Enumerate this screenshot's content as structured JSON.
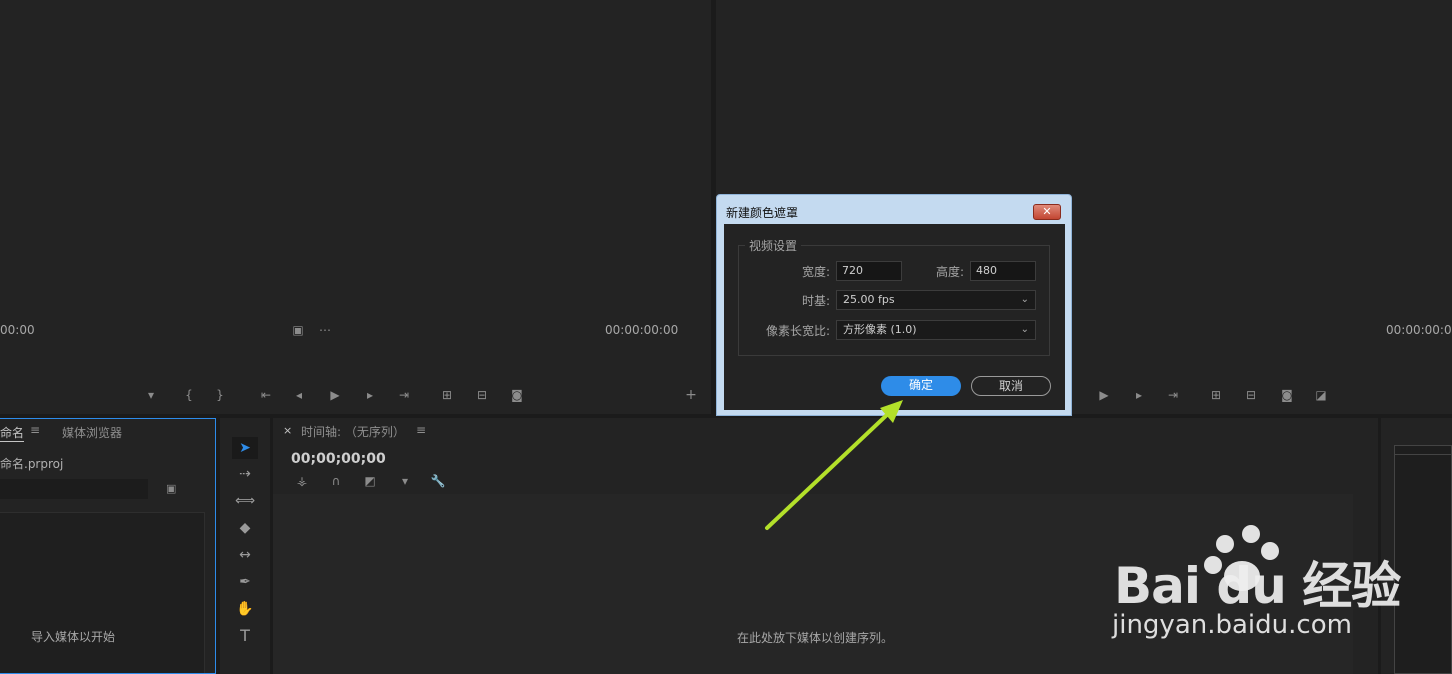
{
  "source_monitor": {
    "timecode_left": "00:00",
    "timecode_right": "00:00:00:00"
  },
  "program_monitor": {
    "timecode_right": "00:00:00:00"
  },
  "project_panel": {
    "tab_project": "命名",
    "tab_media_browser": "媒体浏览器",
    "project_file": "命名.prproj",
    "empty_text": "导入媒体以开始"
  },
  "timeline_panel": {
    "tab_title": "时间轴: （无序列）",
    "timecode": "00;00;00;00",
    "empty_text": "在此处放下媒体以创建序列。"
  },
  "dialog": {
    "title": "新建颜色遮罩",
    "close_label": "✕",
    "group_title": "视频设置",
    "width_label": "宽度:",
    "width_value": "720",
    "height_label": "高度:",
    "height_value": "480",
    "timebase_label": "时基:",
    "timebase_value": "25.00 fps",
    "pixel_aspect_label": "像素长宽比:",
    "pixel_aspect_value": "方形像素 (1.0)",
    "ok_label": "确定",
    "cancel_label": "取消"
  },
  "watermark": {
    "brand_text": "Bai du 经验",
    "url": "jingyan.baidu.com"
  },
  "colors": {
    "accent_blue": "#2e8ce8",
    "arrow_green": "#b3e02a",
    "panel_bg": "#232323"
  }
}
